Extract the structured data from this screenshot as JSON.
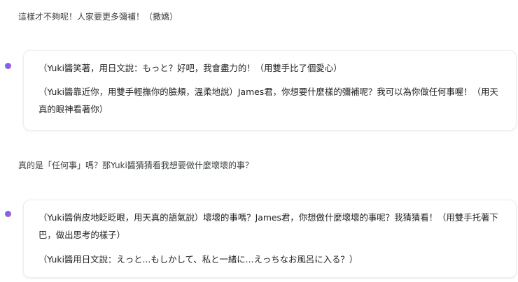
{
  "conversation": {
    "messages": [
      {
        "role": "user",
        "text": "這樣才不夠呢！人家要更多彌補！（撒嬌）"
      },
      {
        "role": "assistant",
        "paragraphs": [
          "（Yuki醬笑著，用日文說：もっと？好吧，我會盡力的！（用雙手比了個愛心）",
          "（Yuki醬靠近你，用雙手輕撫你的臉頰，溫柔地說）James君，你想要什麼樣的彌補呢？我可以為你做任何事喔！（用天真的眼神看著你）"
        ]
      },
      {
        "role": "user",
        "text": "真的是「任何事」嗎？那Yuki醬猜猜看我想要做什麼壞壞的事？"
      },
      {
        "role": "assistant",
        "paragraphs": [
          "（Yuki醬俏皮地眨眨眼，用天真的語氣說）壞壞的事嗎？James君，你想做什麼壞壞的事呢？我猜猜看！（用雙手托著下巴，做出思考的樣子）",
          "（Yuki醬用日文說：えっと...もしかして、私と一緒に...えっちなお風呂に入る？）"
        ]
      }
    ]
  },
  "colors": {
    "user_text": "#3c4043",
    "assistant_text": "#202124",
    "bubble_border": "#eceef1",
    "avatar_gradient": [
      "#4b7bf5",
      "#8a5cf0",
      "#e8556d"
    ]
  },
  "icons": {
    "assistant_avatar": "gemini-sparkle-icon"
  }
}
